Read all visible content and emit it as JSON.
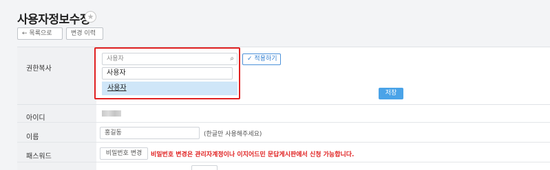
{
  "header": {
    "title": "사용자정보수정",
    "back_label": "목록으로",
    "history_label": "변경 이력"
  },
  "permission": {
    "label": "권한복사",
    "search_placeholder": "사용자",
    "typed_value": "사용자",
    "option": "사용자",
    "apply_label": "적용하기",
    "save_label": "저장"
  },
  "form": {
    "id_label": "아이디",
    "name_label": "이름",
    "name_value": "홍길동",
    "name_hint": "(한글만 사용해주세요)",
    "password_label": "패스워드",
    "password_button": "비밀번호 변경",
    "password_warning": "비밀번호 변경은 관리자계정이나 이지어드민 문답게시판에서 신청 가능합니다."
  },
  "icons": [
    "star-icon",
    "back-arrow-icon",
    "search-icon",
    "check-icon"
  ],
  "colors": {
    "accent": "#4aa3e8",
    "highlight": "#e02020"
  }
}
